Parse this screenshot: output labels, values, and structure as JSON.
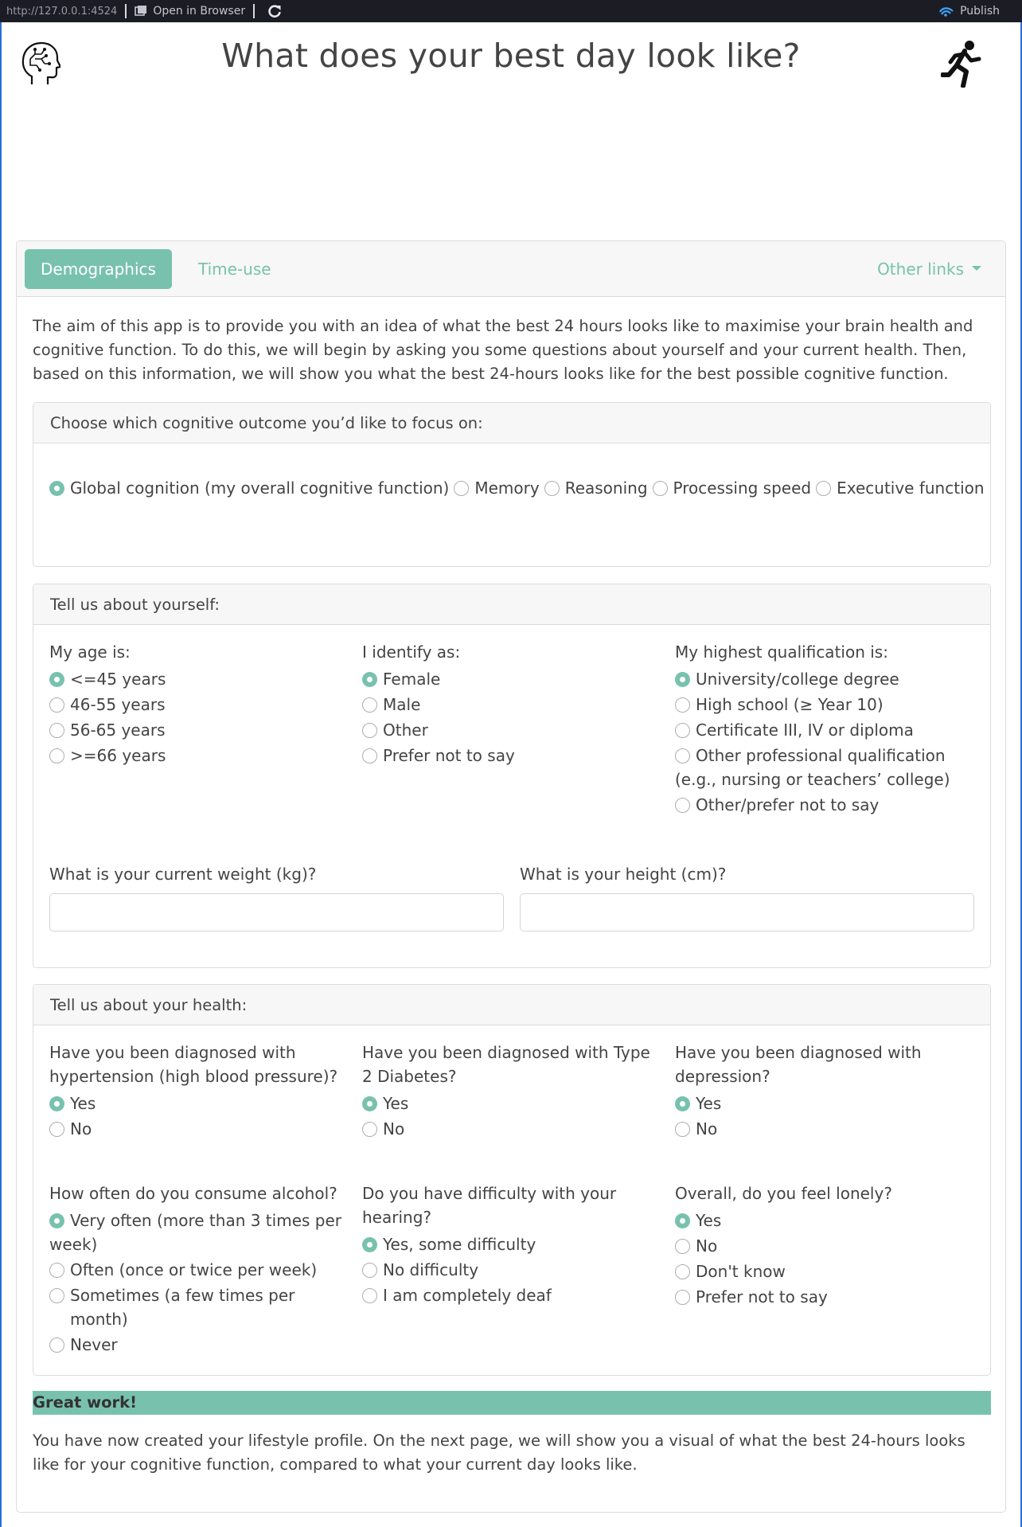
{
  "browser": {
    "url": "http://127.0.0.1:4524",
    "open_in_browser": "Open in Browser",
    "publish": "Publish"
  },
  "page": {
    "title": "What does your best day look like?"
  },
  "tabs": {
    "demographics": "Demographics",
    "time_use": "Time-use",
    "other_links": "Other links"
  },
  "intro": "The aim of this app is to provide you with an idea of what the best 24 hours looks like to maximise your brain health and cognitive function. To do this, we will begin by asking you some questions about yourself and your current health. Then, based on this information, we will show you what the best 24-hours looks like for the best possible cognitive function.",
  "outcome": {
    "heading": "Choose which cognitive outcome you’d like to focus on:",
    "options": [
      {
        "label": "Global cognition (my overall cognitive function)",
        "selected": true
      },
      {
        "label": "Memory",
        "selected": false
      },
      {
        "label": "Reasoning",
        "selected": false
      },
      {
        "label": "Processing speed",
        "selected": false
      },
      {
        "label": "Executive function",
        "selected": false
      }
    ]
  },
  "about": {
    "heading": "Tell us about yourself:",
    "age": {
      "label": "My age is:",
      "options": [
        {
          "label": "<=45 years",
          "selected": true
        },
        {
          "label": "46-55 years",
          "selected": false
        },
        {
          "label": "56-65 years",
          "selected": false
        },
        {
          "label": ">=66 years",
          "selected": false
        }
      ]
    },
    "identity": {
      "label": "I identify as:",
      "options": [
        {
          "label": "Female",
          "selected": true
        },
        {
          "label": "Male",
          "selected": false
        },
        {
          "label": "Other",
          "selected": false
        },
        {
          "label": "Prefer not to say",
          "selected": false
        }
      ]
    },
    "qualification": {
      "label": "My highest qualification is:",
      "options": [
        {
          "label": "University/college degree",
          "selected": true
        },
        {
          "label": "High school (≥ Year 10)",
          "selected": false
        },
        {
          "label": "Certificate III, IV or diploma",
          "selected": false
        },
        {
          "label": "Other professional qualification (e.g., nursing or teachers’ college)",
          "selected": false
        },
        {
          "label": "Other/prefer not to say",
          "selected": false
        }
      ]
    },
    "weight_label": "What is your current weight (kg)?",
    "weight_value": "",
    "height_label": "What is your height (cm)?",
    "height_value": ""
  },
  "health": {
    "heading": "Tell us about your health:",
    "hypertension": {
      "label": "Have you been diagnosed with hypertension (high blood pressure)?",
      "options": [
        {
          "label": "Yes",
          "selected": true
        },
        {
          "label": "No",
          "selected": false
        }
      ]
    },
    "diabetes": {
      "label": "Have you been diagnosed with Type 2 Diabetes?",
      "options": [
        {
          "label": "Yes",
          "selected": true
        },
        {
          "label": "No",
          "selected": false
        }
      ]
    },
    "depression": {
      "label": "Have you been diagnosed with depression?",
      "options": [
        {
          "label": "Yes",
          "selected": true
        },
        {
          "label": "No",
          "selected": false
        }
      ]
    },
    "alcohol": {
      "label": "How often do you consume alcohol?",
      "options": [
        {
          "label": "Very often (more than 3 times per week)",
          "selected": true
        },
        {
          "label": "Often (once or twice per week)",
          "selected": false
        },
        {
          "label": "Sometimes (a few times per month)",
          "selected": false
        },
        {
          "label": "Never",
          "selected": false
        }
      ]
    },
    "hearing": {
      "label": "Do you have difficulty with your hearing?",
      "options": [
        {
          "label": "Yes, some difficulty",
          "selected": true
        },
        {
          "label": "No difficulty",
          "selected": false
        },
        {
          "label": "I am completely deaf",
          "selected": false
        }
      ]
    },
    "lonely": {
      "label": "Overall, do you feel lonely?",
      "options": [
        {
          "label": "Yes",
          "selected": true
        },
        {
          "label": "No",
          "selected": false
        },
        {
          "label": "Don't know",
          "selected": false
        },
        {
          "label": "Prefer not to say",
          "selected": false
        }
      ]
    }
  },
  "great_work": "Great work!",
  "outro": "You have now created your lifestyle profile. On the next page, we will show you a visual of what the best 24-hours looks like for your cognitive function, compared to what your current day looks like.",
  "colors": {
    "accent": "#78c2ad",
    "topbar": "#1c1c24",
    "frame_border": "#2b6fd6"
  },
  "icons": {
    "header_left": "brain-head-icon",
    "header_right": "running-person-icon"
  }
}
